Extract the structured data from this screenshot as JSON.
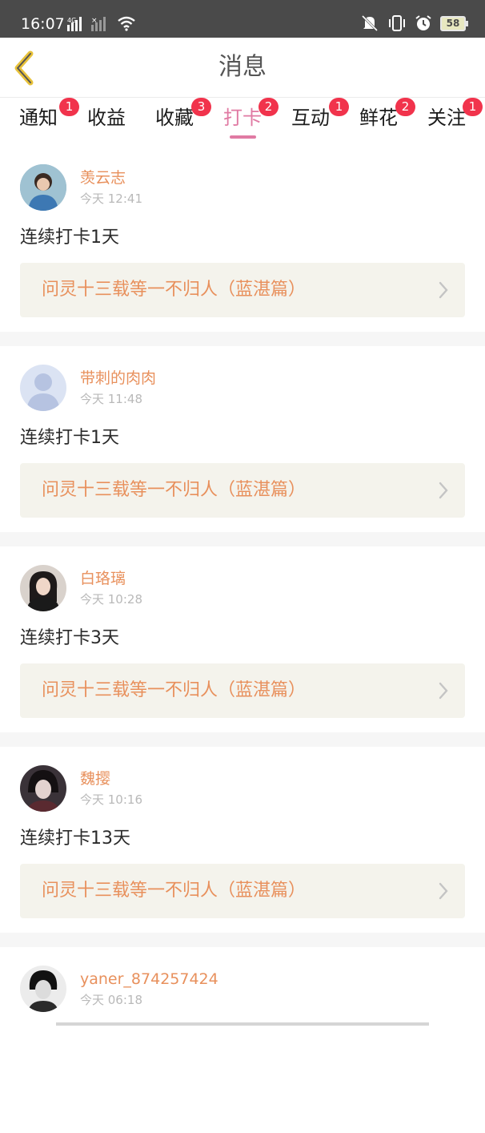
{
  "status_bar": {
    "time": "16:07",
    "battery": "58"
  },
  "header": {
    "title": "消息"
  },
  "tabs": [
    {
      "label": "通知",
      "badge": "1"
    },
    {
      "label": "收益",
      "badge": ""
    },
    {
      "label": "收藏",
      "badge": "3"
    },
    {
      "label": "打卡",
      "badge": "2",
      "active": true
    },
    {
      "label": "互动",
      "badge": "1"
    },
    {
      "label": "鲜花",
      "badge": "2"
    },
    {
      "label": "关注",
      "badge": "1"
    }
  ],
  "feed": [
    {
      "name": "羡云志",
      "time": "今天 12:41",
      "text": "连续打卡1天",
      "book": "问灵十三载等一不归人（蓝湛篇）"
    },
    {
      "name": "带刺的肉肉",
      "time": "今天 11:48",
      "text": "连续打卡1天",
      "book": "问灵十三载等一不归人（蓝湛篇）"
    },
    {
      "name": "白珞璃",
      "time": "今天 10:28",
      "text": "连续打卡3天",
      "book": "问灵十三载等一不归人（蓝湛篇）"
    },
    {
      "name": "魏撄",
      "time": "今天 10:16",
      "text": "连续打卡13天",
      "book": "问灵十三载等一不归人（蓝湛篇）"
    },
    {
      "name": "yaner_874257424",
      "time": "今天 06:18",
      "text": "",
      "book": ""
    }
  ],
  "colors": {
    "accent": "#e07aa3",
    "badge": "#f1334c",
    "name": "#e8905c",
    "back": "#e8c23a"
  }
}
